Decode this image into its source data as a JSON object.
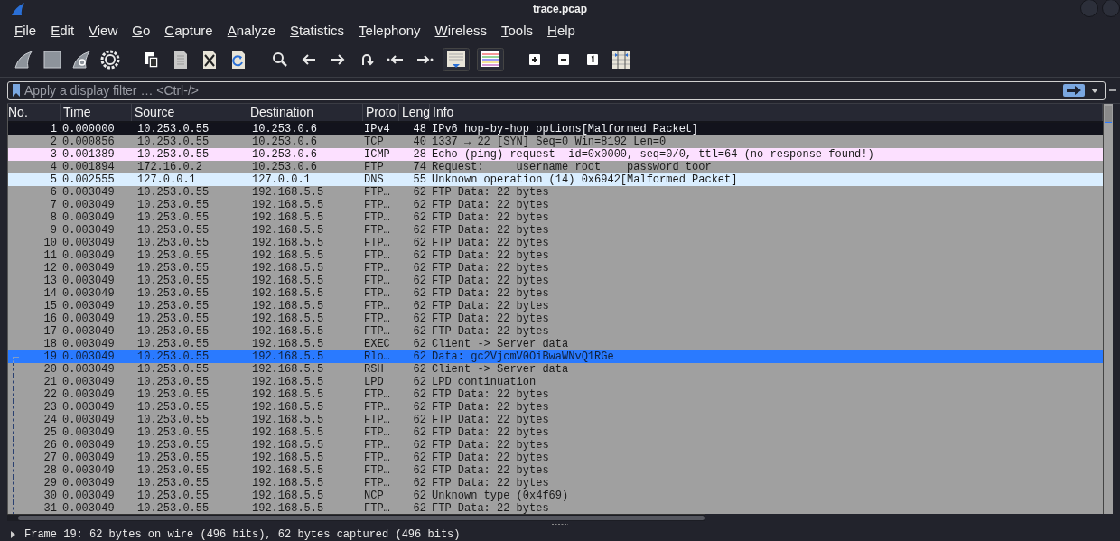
{
  "window": {
    "title": "trace.pcap"
  },
  "menu": [
    "File",
    "Edit",
    "View",
    "Go",
    "Capture",
    "Analyze",
    "Statistics",
    "Telephony",
    "Wireless",
    "Tools",
    "Help"
  ],
  "toolbar": [
    {
      "kind": "fin"
    },
    {
      "kind": "stop"
    },
    {
      "kind": "restart"
    },
    {
      "kind": "gear"
    },
    {
      "kind": "sep"
    },
    {
      "kind": "open"
    },
    {
      "kind": "file"
    },
    {
      "kind": "close"
    },
    {
      "kind": "reload"
    },
    {
      "kind": "sep"
    },
    {
      "kind": "search"
    },
    {
      "kind": "back"
    },
    {
      "kind": "forward"
    },
    {
      "kind": "jump"
    },
    {
      "kind": "first"
    },
    {
      "kind": "last"
    },
    {
      "kind": "autoscroll"
    },
    {
      "kind": "colorize"
    },
    {
      "kind": "sep"
    },
    {
      "kind": "zoomin"
    },
    {
      "kind": "zoomout"
    },
    {
      "kind": "normal"
    },
    {
      "kind": "resize"
    }
  ],
  "filter": {
    "placeholder": "Apply a display filter … <Ctrl-/>"
  },
  "table": {
    "columns": [
      "No.",
      "Time",
      "Source",
      "Destination",
      "Proto",
      "Leng",
      "Info"
    ],
    "rows": [
      {
        "cells": [
          "1",
          "0.000000",
          "10.253.0.55",
          "10.253.0.6",
          "IPv4",
          "48",
          "IPv6 hop-by-hop options[Malformed Packet]"
        ],
        "color": "#12131c",
        "selected": false,
        "related": false
      },
      {
        "cells": [
          "2",
          "0.000856",
          "10.253.0.55",
          "10.253.0.6",
          "TCP",
          "40",
          "1337 → 22 [SYN] Seq=0 Win=8192 Len=0"
        ],
        "color": "#a0a0a0",
        "selected": false,
        "related": false
      },
      {
        "cells": [
          "3",
          "0.001389",
          "10.253.0.55",
          "10.253.0.6",
          "ICMP",
          "28",
          "Echo (ping) request  id=0x0000, seq=0/0, ttl=64 (no response found!)"
        ],
        "color": "#fce0ff",
        "selected": false,
        "related": false
      },
      {
        "cells": [
          "4",
          "0.001894",
          "172.16.0.2",
          "10.253.0.6",
          "FTP",
          "74",
          "Request:     username root    password toor"
        ],
        "color": "#a0a0a0",
        "selected": false,
        "related": false
      },
      {
        "cells": [
          "5",
          "0.002555",
          "127.0.0.1",
          "127.0.0.1",
          "DNS",
          "55",
          "Unknown operation (14) 0x6942[Malformed Packet]"
        ],
        "color": "#daeeff",
        "selected": false,
        "related": false
      },
      {
        "cells": [
          "6",
          "0.003049",
          "10.253.0.55",
          "192.168.5.5",
          "FTP…",
          "62",
          "FTP Data: 22 bytes"
        ],
        "color": "#a0a0a0",
        "selected": false,
        "related": false
      },
      {
        "cells": [
          "7",
          "0.003049",
          "10.253.0.55",
          "192.168.5.5",
          "FTP…",
          "62",
          "FTP Data: 22 bytes"
        ],
        "color": "#a0a0a0",
        "selected": false,
        "related": false
      },
      {
        "cells": [
          "8",
          "0.003049",
          "10.253.0.55",
          "192.168.5.5",
          "FTP…",
          "62",
          "FTP Data: 22 bytes"
        ],
        "color": "#a0a0a0",
        "selected": false,
        "related": false
      },
      {
        "cells": [
          "9",
          "0.003049",
          "10.253.0.55",
          "192.168.5.5",
          "FTP…",
          "62",
          "FTP Data: 22 bytes"
        ],
        "color": "#a0a0a0",
        "selected": false,
        "related": false
      },
      {
        "cells": [
          "10",
          "0.003049",
          "10.253.0.55",
          "192.168.5.5",
          "FTP…",
          "62",
          "FTP Data: 22 bytes"
        ],
        "color": "#a0a0a0",
        "selected": false,
        "related": false
      },
      {
        "cells": [
          "11",
          "0.003049",
          "10.253.0.55",
          "192.168.5.5",
          "FTP…",
          "62",
          "FTP Data: 22 bytes"
        ],
        "color": "#a0a0a0",
        "selected": false,
        "related": false
      },
      {
        "cells": [
          "12",
          "0.003049",
          "10.253.0.55",
          "192.168.5.5",
          "FTP…",
          "62",
          "FTP Data: 22 bytes"
        ],
        "color": "#a0a0a0",
        "selected": false,
        "related": false
      },
      {
        "cells": [
          "13",
          "0.003049",
          "10.253.0.55",
          "192.168.5.5",
          "FTP…",
          "62",
          "FTP Data: 22 bytes"
        ],
        "color": "#a0a0a0",
        "selected": false,
        "related": false
      },
      {
        "cells": [
          "14",
          "0.003049",
          "10.253.0.55",
          "192.168.5.5",
          "FTP…",
          "62",
          "FTP Data: 22 bytes"
        ],
        "color": "#a0a0a0",
        "selected": false,
        "related": false
      },
      {
        "cells": [
          "15",
          "0.003049",
          "10.253.0.55",
          "192.168.5.5",
          "FTP…",
          "62",
          "FTP Data: 22 bytes"
        ],
        "color": "#a0a0a0",
        "selected": false,
        "related": false
      },
      {
        "cells": [
          "16",
          "0.003049",
          "10.253.0.55",
          "192.168.5.5",
          "FTP…",
          "62",
          "FTP Data: 22 bytes"
        ],
        "color": "#a0a0a0",
        "selected": false,
        "related": false
      },
      {
        "cells": [
          "17",
          "0.003049",
          "10.253.0.55",
          "192.168.5.5",
          "FTP…",
          "62",
          "FTP Data: 22 bytes"
        ],
        "color": "#a0a0a0",
        "selected": false,
        "related": false
      },
      {
        "cells": [
          "18",
          "0.003049",
          "10.253.0.55",
          "192.168.5.5",
          "EXEC",
          "62",
          "Client -> Server data"
        ],
        "color": "#a0a0a0",
        "selected": false,
        "related": false
      },
      {
        "cells": [
          "19",
          "0.003049",
          "10.253.0.55",
          "192.168.5.5",
          "Rlo…",
          "62",
          "Data: gc2VjcmV0OiBwaWNvQ1RGe"
        ],
        "selected": true,
        "related": true
      },
      {
        "cells": [
          "20",
          "0.003049",
          "10.253.0.55",
          "192.168.5.5",
          "RSH",
          "62",
          "Client -> Server data"
        ],
        "color": "#a0a0a0",
        "selected": false,
        "related": true
      },
      {
        "cells": [
          "21",
          "0.003049",
          "10.253.0.55",
          "192.168.5.5",
          "LPD",
          "62",
          "LPD continuation"
        ],
        "color": "#a0a0a0",
        "selected": false,
        "related": true
      },
      {
        "cells": [
          "22",
          "0.003049",
          "10.253.0.55",
          "192.168.5.5",
          "FTP…",
          "62",
          "FTP Data: 22 bytes"
        ],
        "color": "#a0a0a0",
        "selected": false,
        "related": true
      },
      {
        "cells": [
          "23",
          "0.003049",
          "10.253.0.55",
          "192.168.5.5",
          "FTP…",
          "62",
          "FTP Data: 22 bytes"
        ],
        "color": "#a0a0a0",
        "selected": false,
        "related": true
      },
      {
        "cells": [
          "24",
          "0.003049",
          "10.253.0.55",
          "192.168.5.5",
          "FTP…",
          "62",
          "FTP Data: 22 bytes"
        ],
        "color": "#a0a0a0",
        "selected": false,
        "related": true
      },
      {
        "cells": [
          "25",
          "0.003049",
          "10.253.0.55",
          "192.168.5.5",
          "FTP…",
          "62",
          "FTP Data: 22 bytes"
        ],
        "color": "#a0a0a0",
        "selected": false,
        "related": true
      },
      {
        "cells": [
          "26",
          "0.003049",
          "10.253.0.55",
          "192.168.5.5",
          "FTP…",
          "62",
          "FTP Data: 22 bytes"
        ],
        "color": "#a0a0a0",
        "selected": false,
        "related": true
      },
      {
        "cells": [
          "27",
          "0.003049",
          "10.253.0.55",
          "192.168.5.5",
          "FTP…",
          "62",
          "FTP Data: 22 bytes"
        ],
        "color": "#a0a0a0",
        "selected": false,
        "related": true
      },
      {
        "cells": [
          "28",
          "0.003049",
          "10.253.0.55",
          "192.168.5.5",
          "FTP…",
          "62",
          "FTP Data: 22 bytes"
        ],
        "color": "#a0a0a0",
        "selected": false,
        "related": true
      },
      {
        "cells": [
          "29",
          "0.003049",
          "10.253.0.55",
          "192.168.5.5",
          "FTP…",
          "62",
          "FTP Data: 22 bytes"
        ],
        "color": "#a0a0a0",
        "selected": false,
        "related": true
      },
      {
        "cells": [
          "30",
          "0.003049",
          "10.253.0.55",
          "192.168.5.5",
          "NCP",
          "62",
          "Unknown type (0x4f69)"
        ],
        "color": "#a0a0a0",
        "selected": false,
        "related": true
      },
      {
        "cells": [
          "31",
          "0.003049",
          "10.253.0.55",
          "192.168.5.5",
          "FTP…",
          "62",
          "FTP Data: 22 bytes"
        ],
        "color": "#a0a0a0",
        "selected": false,
        "related": true
      }
    ]
  },
  "details": [
    {
      "text": "Frame 19: 62 bytes on wire (496 bits), 62 bytes captured (496 bits)",
      "expanded": false
    }
  ]
}
